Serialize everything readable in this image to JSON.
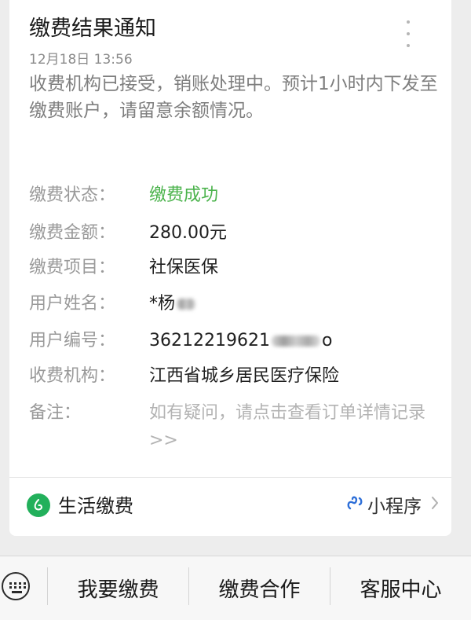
{
  "card": {
    "title": "缴费结果通知",
    "time": "12月18日 13:56",
    "description": "收费机构已接受，销账处理中。预计1小时内下发至缴费账户，请留意余额情况。",
    "fields": {
      "status": {
        "label": "缴费状态：",
        "value": "缴费成功"
      },
      "amount": {
        "label": "缴费金额：",
        "value": "280.00元"
      },
      "item": {
        "label": "缴费项目：",
        "value": "社保医保"
      },
      "name": {
        "label": "用户姓名：",
        "value_visible": "*杨"
      },
      "number": {
        "label": "用户编号：",
        "value_prefix": "36212219621",
        "value_suffix": "o"
      },
      "org": {
        "label": "收费机构：",
        "value": "江西省城乡居民医疗保险"
      },
      "note": {
        "label": "备注：",
        "value": "如有疑问，请点击查看订单详情记录>>"
      }
    },
    "footer": {
      "service_name": "生活缴费",
      "mini_program_label": "小程序"
    }
  },
  "bottom_menu": {
    "items": [
      "我要缴费",
      "缴费合作",
      "客服中心"
    ]
  },
  "colors": {
    "success": "#4bb34c",
    "service_icon": "#22b05b",
    "mini_program_icon": "#2e6fd8"
  },
  "icons": [
    "more-icon",
    "life-payment-icon",
    "mini-program-icon",
    "chevron-right-icon",
    "keyboard-icon"
  ]
}
